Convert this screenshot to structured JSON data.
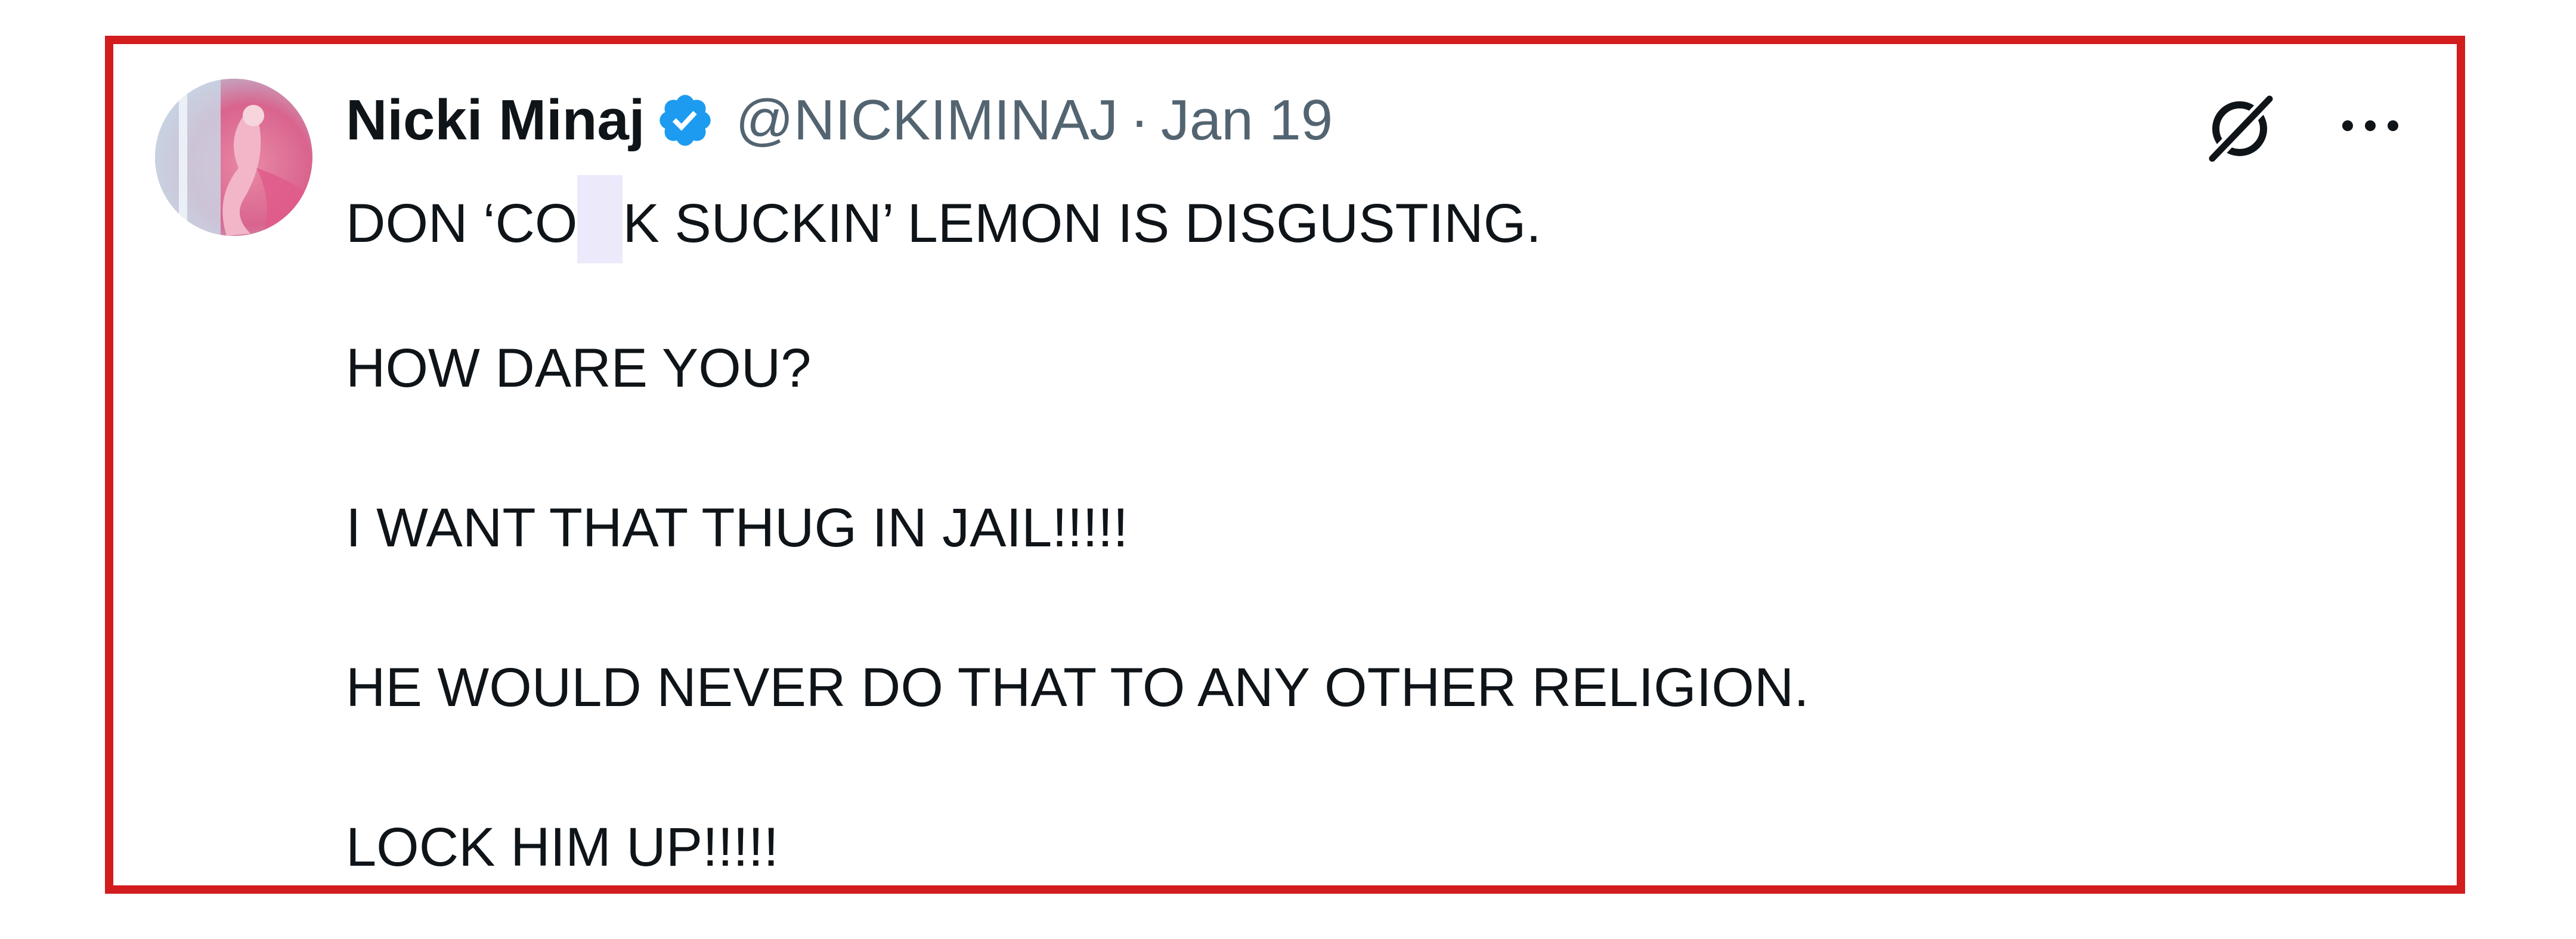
{
  "tweet": {
    "author_name": "Nicki Minaj",
    "handle": "@NICKIMINAJ",
    "separator": "·",
    "date": "Jan 19",
    "verified_color": "#1d9bf0",
    "icons": {
      "verified": "verified-badge-icon",
      "grok": "grok-icon",
      "more": "more-options-icon"
    },
    "lines": [
      {
        "before_censor": "DON ‘CO",
        "after_censor": "K SUCKIN’ LEMON IS DISGUSTING."
      },
      {
        "text": "HOW DARE YOU?"
      },
      {
        "text": "I WANT THAT THUG IN JAIL!!!!!"
      },
      {
        "text": "HE WOULD NEVER DO THAT TO ANY OTHER RELIGION."
      },
      {
        "text": "LOCK HIM UP!!!!!"
      }
    ]
  },
  "frame_color": "#d21c1e"
}
